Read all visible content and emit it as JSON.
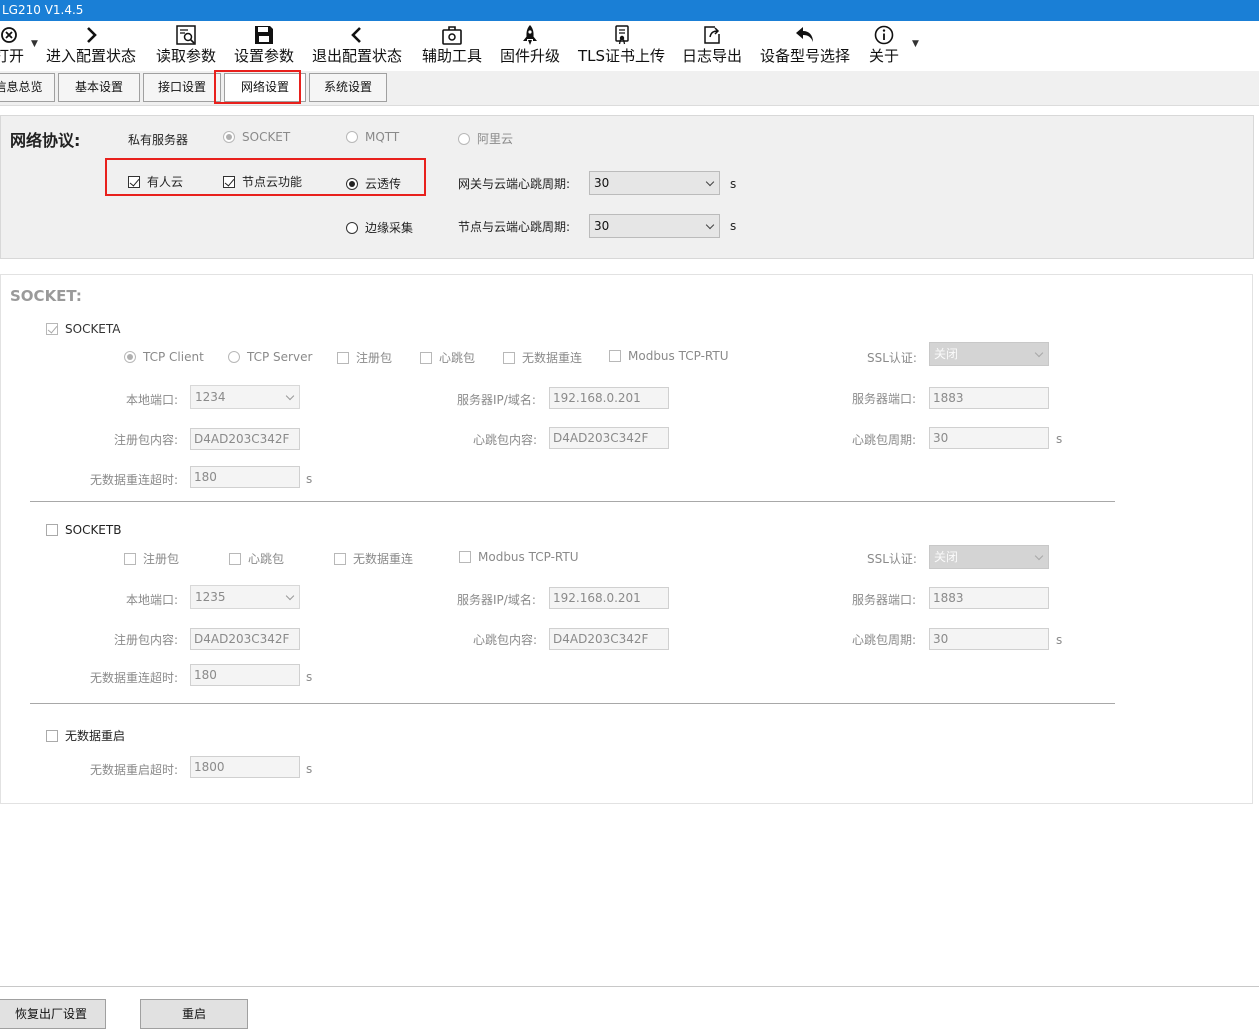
{
  "window": {
    "title": "LG210 V1.4.5"
  },
  "toolbar": {
    "items": [
      {
        "label": "打开",
        "icon": "open-icon"
      },
      {
        "label": "进入配置状态",
        "icon": "chevron-right-icon"
      },
      {
        "label": "读取参数",
        "icon": "read-params-icon"
      },
      {
        "label": "设置参数",
        "icon": "save-icon"
      },
      {
        "label": "退出配置状态",
        "icon": "chevron-left-icon"
      },
      {
        "label": "辅助工具",
        "icon": "toolbox-icon"
      },
      {
        "label": "固件升级",
        "icon": "rocket-icon"
      },
      {
        "label": "TLS证书上传",
        "icon": "certificate-icon"
      },
      {
        "label": "日志导出",
        "icon": "export-icon"
      },
      {
        "label": "设备型号选择",
        "icon": "undo-arrow-icon"
      },
      {
        "label": "关于",
        "icon": "info-icon"
      }
    ]
  },
  "tabs": [
    {
      "label": "信息总览"
    },
    {
      "label": "基本设置"
    },
    {
      "label": "接口设置"
    },
    {
      "label": "网络设置",
      "active": true
    },
    {
      "label": "系统设置"
    }
  ],
  "protocol": {
    "title": "网络协议:",
    "private_server_label": "私有服务器",
    "options": {
      "socket": "SOCKET",
      "mqtt": "MQTT",
      "aliyun": "阿里云"
    },
    "selected": "SOCKET",
    "youren_cloud": {
      "label": "有人云",
      "checked": true
    },
    "node_cloud": {
      "label": "节点云功能",
      "checked": true
    },
    "cloud_transparent": {
      "label": "云透传",
      "checked": true
    },
    "edge_collect": {
      "label": "边缘采集",
      "checked": false
    },
    "gateway_heartbeat": {
      "label": "网关与云端心跳周期:",
      "value": "30",
      "unit": "s"
    },
    "node_heartbeat": {
      "label": "节点与云端心跳周期:",
      "value": "30",
      "unit": "s"
    }
  },
  "socket": {
    "title": "SOCKET:",
    "socket_a": {
      "label": "SOCKETA",
      "enabled": true,
      "mode_tcp_client": "TCP Client",
      "mode_tcp_server": "TCP Server",
      "register_packet": "注册包",
      "heartbeat_packet": "心跳包",
      "no_data_reconnect": "无数据重连",
      "modbus_tcp_rtu": "Modbus TCP-RTU",
      "ssl_label": "SSL认证:",
      "ssl_value": "关闭",
      "local_port_label": "本地端口:",
      "local_port_value": "1234",
      "server_ip_label": "服务器IP/域名:",
      "server_ip_value": "192.168.0.201",
      "server_port_label": "服务器端口:",
      "server_port_value": "1883",
      "register_content_label": "注册包内容:",
      "register_content_value": "D4AD203C342F",
      "heartbeat_content_label": "心跳包内容:",
      "heartbeat_content_value": "D4AD203C342F",
      "heartbeat_period_label": "心跳包周期:",
      "heartbeat_period_value": "30",
      "heartbeat_period_unit": "s",
      "reconnect_timeout_label": "无数据重连超时:",
      "reconnect_timeout_value": "180",
      "reconnect_timeout_unit": "s"
    },
    "socket_b": {
      "label": "SOCKETB",
      "enabled": false,
      "register_packet": "注册包",
      "heartbeat_packet": "心跳包",
      "no_data_reconnect": "无数据重连",
      "modbus_tcp_rtu": "Modbus TCP-RTU",
      "ssl_label": "SSL认证:",
      "ssl_value": "关闭",
      "local_port_label": "本地端口:",
      "local_port_value": "1235",
      "server_ip_label": "服务器IP/域名:",
      "server_ip_value": "192.168.0.201",
      "server_port_label": "服务器端口:",
      "server_port_value": "1883",
      "register_content_label": "注册包内容:",
      "register_content_value": "D4AD203C342F",
      "heartbeat_content_label": "心跳包内容:",
      "heartbeat_content_value": "D4AD203C342F",
      "heartbeat_period_label": "心跳包周期:",
      "heartbeat_period_value": "30",
      "heartbeat_period_unit": "s",
      "reconnect_timeout_label": "无数据重连超时:",
      "reconnect_timeout_value": "180",
      "reconnect_timeout_unit": "s"
    },
    "no_data_restart": {
      "label": "无数据重启",
      "enabled": false,
      "timeout_label": "无数据重启超时:",
      "timeout_value": "1800",
      "timeout_unit": "s"
    }
  },
  "footer": {
    "factory_reset": "恢复出厂设置",
    "restart": "重启"
  }
}
